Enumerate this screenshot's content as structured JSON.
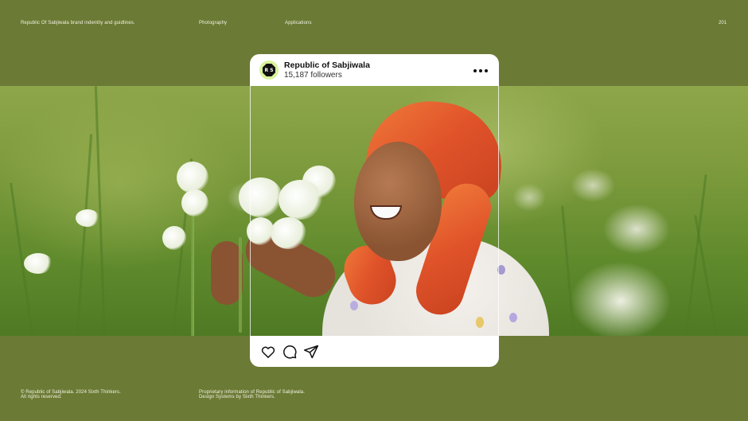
{
  "header": {
    "brand_note": "Republic Of Sabjiwala brand indentity and guidlines.",
    "section": "Photography",
    "subsection": "Applications",
    "page_number": "201"
  },
  "post": {
    "account_name": "Republic of Sabjiwala",
    "followers": "15,187 followers",
    "avatar_icon": "rs-logo-icon",
    "menu_icon": "more-dots-icon",
    "actions": [
      "heart-icon",
      "comment-icon",
      "share-icon"
    ]
  },
  "footer": {
    "copyright_line1": "© Republic of Sabjiwala. 2024 Sixth Thinkers.",
    "copyright_line2": "All rights reserved.",
    "proprietary_line1": "Proprietary information of Republic of Sabjiwala.",
    "proprietary_line2": "Design Systems by Sixth Thinkers."
  },
  "colors": {
    "background": "#6b7a34",
    "card": "#ffffff",
    "avatar_bg": "#d8f29a"
  }
}
